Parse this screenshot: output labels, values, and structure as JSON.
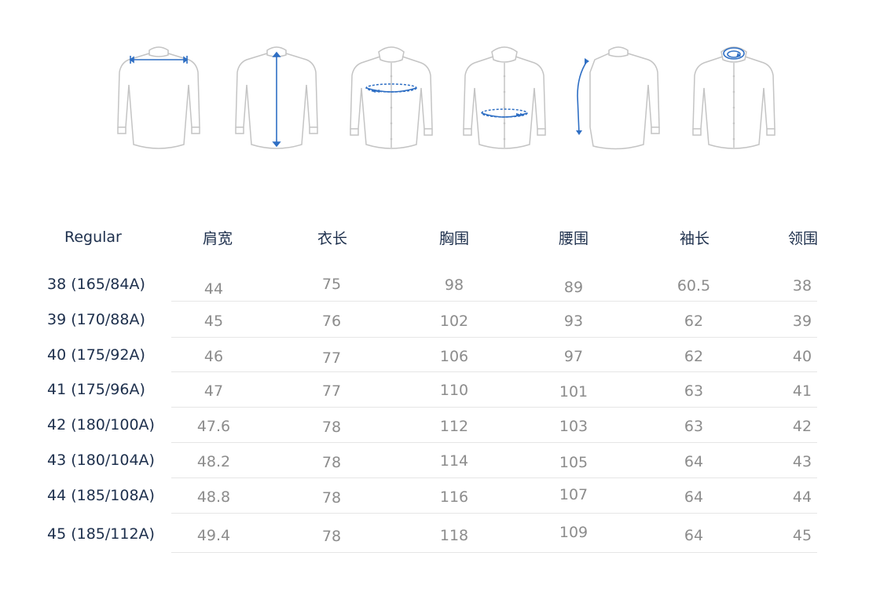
{
  "colors": {
    "header_text": "#1d2f4c",
    "value_text": "#8c8c8c",
    "divider": "#e6e6e6",
    "shirt_outline": "#c4c4c4",
    "measure_accent": "#2f6fc4"
  },
  "illustrations": [
    {
      "icon": "shoulder-width-shirt-icon"
    },
    {
      "icon": "length-shirt-icon"
    },
    {
      "icon": "chest-shirt-icon"
    },
    {
      "icon": "waist-shirt-icon"
    },
    {
      "icon": "sleeve-shirt-icon"
    },
    {
      "icon": "collar-shirt-icon"
    }
  ],
  "table": {
    "fit_label": "Regular",
    "columns": [
      "肩宽",
      "衣长",
      "胸围",
      "腰围",
      "袖长",
      "领围"
    ],
    "rows": [
      {
        "size": "38 (165/84A)",
        "values": [
          "44",
          "75",
          "98",
          "89",
          "60.5",
          "38"
        ]
      },
      {
        "size": "39 (170/88A)",
        "values": [
          "45",
          "76",
          "102",
          "93",
          "62",
          "39"
        ]
      },
      {
        "size": "40 (175/92A)",
        "values": [
          "46",
          "77",
          "106",
          "97",
          "62",
          "40"
        ]
      },
      {
        "size": "41 (175/96A)",
        "values": [
          "47",
          "77",
          "110",
          "101",
          "63",
          "41"
        ]
      },
      {
        "size": "42 (180/100A)",
        "values": [
          "47.6",
          "78",
          "112",
          "103",
          "63",
          "42"
        ]
      },
      {
        "size": "43 (180/104A)",
        "values": [
          "48.2",
          "78",
          "114",
          "105",
          "64",
          "43"
        ]
      },
      {
        "size": "44 (185/108A)",
        "values": [
          "48.8",
          "78",
          "116",
          "107",
          "64",
          "44"
        ]
      },
      {
        "size": "45 (185/112A)",
        "values": [
          "49.4",
          "78",
          "118",
          "109",
          "64",
          "45"
        ]
      }
    ]
  }
}
